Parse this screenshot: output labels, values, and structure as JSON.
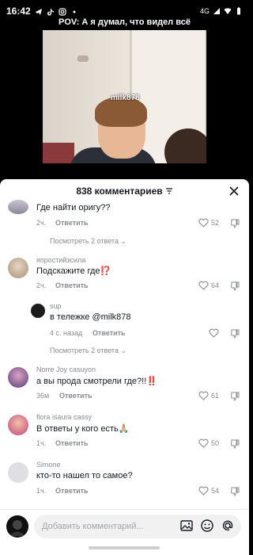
{
  "status_bar": {
    "time": "16:42",
    "network": "4G"
  },
  "video": {
    "title": "POV: А я думал, что видел всё",
    "watermark": "milk878"
  },
  "sheet": {
    "title": "838 комментариев",
    "comments": [
      {
        "username": "",
        "text": "Где найти оригу??",
        "time": "2ч.",
        "reply": "Ответить",
        "likes": "52",
        "view_replies": "Посмотреть 2 ответа"
      },
      {
        "username": "япростийзсила",
        "text": "Подскажите где⁉️",
        "time": "2ч.",
        "reply": "Ответить",
        "likes": "64"
      },
      {
        "username": "sup",
        "text": "в тележке @milk878",
        "time": "4 с. назад",
        "reply": "Ответить",
        "view_replies": "Посмотреть 2 ответа"
      },
      {
        "username": "Norre Joy casuyon",
        "text": "а вы прода смотрели где?!!‼️",
        "time": "36м",
        "reply": "Ответить",
        "likes": "61"
      },
      {
        "username": "flora isaura cassy",
        "text": "В ответы у кого есть🙏🏼",
        "time": "1ч.",
        "reply": "Ответить",
        "likes": "50"
      },
      {
        "username": "Simone",
        "text": "кто-то нашел то самое?",
        "time": "1ч.",
        "reply": "Ответить",
        "likes": "54"
      }
    ]
  },
  "input": {
    "placeholder": "Добавить комментарий..."
  },
  "colors": {
    "text": "#161823",
    "muted": "#8a8b91",
    "red": "#fe2c55"
  }
}
